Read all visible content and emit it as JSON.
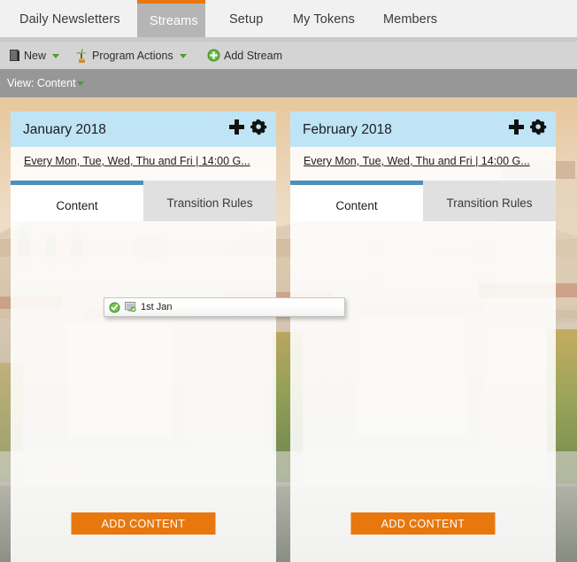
{
  "nav": {
    "tabs": [
      {
        "label": "Daily Newsletters",
        "active": false
      },
      {
        "label": "Streams",
        "active": true
      },
      {
        "label": "Setup",
        "active": false
      },
      {
        "label": "My Tokens",
        "active": false
      },
      {
        "label": "Members",
        "active": false
      }
    ]
  },
  "toolbar": {
    "new_label": "New",
    "program_actions_label": "Program Actions",
    "add_stream_label": "Add Stream"
  },
  "viewbar": {
    "label": "View: Content"
  },
  "streams": [
    {
      "title": "January 2018",
      "schedule": "Every Mon, Tue, Wed, Thu and Fri | 14:00 G...",
      "tabs": [
        {
          "label": "Content",
          "active": true
        },
        {
          "label": "Transition Rules",
          "active": false
        }
      ],
      "add_content_label": "ADD CONTENT"
    },
    {
      "title": "February 2018",
      "schedule": "Every Mon, Tue, Wed, Thu and Fri | 14:00 G...",
      "tabs": [
        {
          "label": "Content",
          "active": true
        },
        {
          "label": "Transition Rules",
          "active": false
        }
      ],
      "add_content_label": "ADD CONTENT"
    }
  ],
  "drag_item": {
    "label": "1st Jan"
  },
  "colors": {
    "accent_orange": "#e8770d",
    "card_header_blue": "#bfe4f5",
    "active_tab_blue": "#4c8fbe",
    "nav_active_gray": "#b5b5b5",
    "toolbar_gray": "#d4d4d4",
    "viewbar_gray": "#979797",
    "status_green": "#4e9b35"
  }
}
